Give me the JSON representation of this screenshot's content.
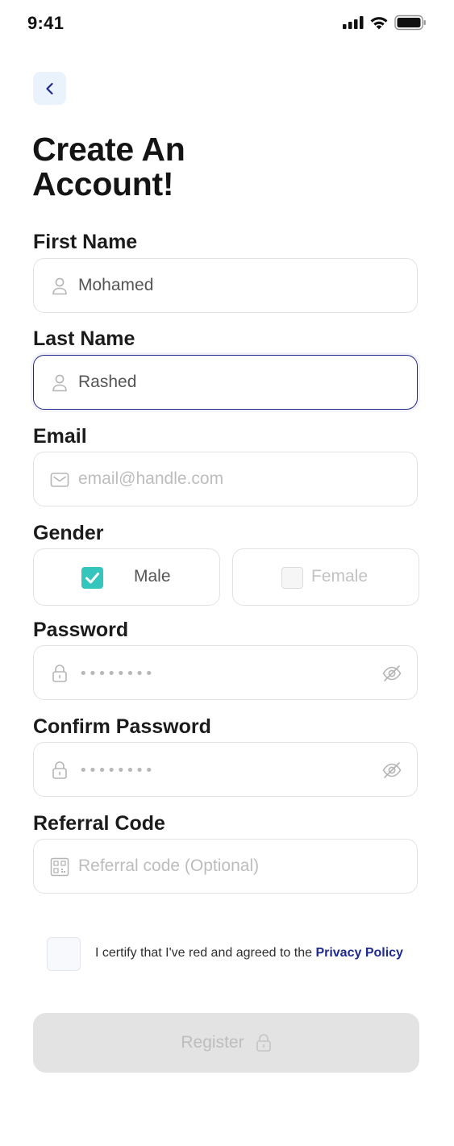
{
  "status_bar": {
    "time": "9:41",
    "icons": [
      "cellular-signal-icon",
      "wifi-icon",
      "battery-icon"
    ]
  },
  "header": {
    "back_icon": "chevron-left-icon",
    "title": "Create An Account!"
  },
  "form": {
    "first_name": {
      "label": "First Name",
      "value": "Mohamed",
      "icon": "user-icon"
    },
    "last_name": {
      "label": "Last Name",
      "value": "Rashed",
      "icon": "user-icon",
      "focused": true
    },
    "email": {
      "label": "Email",
      "value": "",
      "placeholder": "email@handle.com",
      "icon": "mail-icon"
    },
    "gender": {
      "label": "Gender",
      "options": [
        {
          "label": "Male",
          "checked": true
        },
        {
          "label": "Female",
          "checked": false
        }
      ]
    },
    "password": {
      "label": "Password",
      "masked_value": "••••••••",
      "icon": "lock-icon",
      "toggle_icon": "eye-off-icon"
    },
    "confirm_password": {
      "label": "Confirm Password",
      "masked_value": "••••••••",
      "icon": "lock-icon",
      "toggle_icon": "eye-off-icon"
    },
    "referral_code": {
      "label": "Referral Code",
      "value": "",
      "placeholder": "Referral code (Optional)",
      "icon": "qr-code-icon"
    }
  },
  "consent": {
    "checked": false,
    "text": "I certify that I've red and agreed to the ",
    "link_text": "Privacy Policy"
  },
  "register_button": {
    "label": "Register",
    "icon": "lock-icon",
    "enabled": false
  },
  "colors": {
    "brand_navy": "#1f2a8c",
    "check_teal": "#34c6bc",
    "back_button_bg": "#eaf2fb",
    "disabled_button_bg": "#e3e3e3",
    "field_border": "#e2e2e2"
  }
}
